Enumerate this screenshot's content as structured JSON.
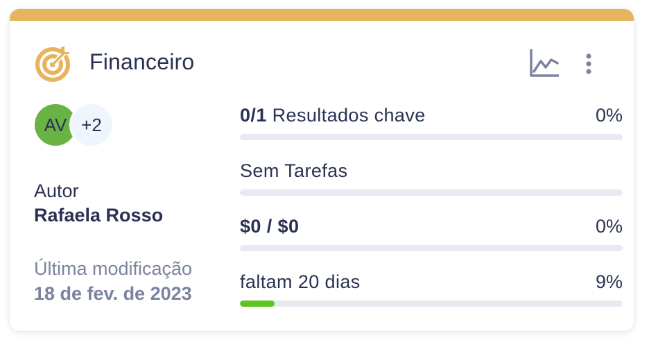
{
  "card": {
    "title": "Financeiro",
    "colors": {
      "accent": "#e7b45e",
      "progress": "#5fc421",
      "avatar": "#69b244"
    },
    "icons": {
      "header": "target-icon",
      "chart": "line-chart-icon",
      "menu": "more-vertical-icon"
    }
  },
  "avatars": {
    "initials": "AV",
    "more": "+2"
  },
  "meta": {
    "author_label": "Autor",
    "author_name": "Rafaela Rosso",
    "modified_label": "Última modificação",
    "modified_date": "18 de fev. de 2023"
  },
  "rows": [
    {
      "bold": "0/1",
      "text": "Resultados chave",
      "percent": "0%",
      "progress": 0
    },
    {
      "bold": "",
      "text": "Sem Tarefas",
      "percent": "",
      "progress": 0
    },
    {
      "bold": "$0 / $0",
      "text": "",
      "percent": "0%",
      "progress": 0
    },
    {
      "bold": "",
      "text": "faltam 20 dias",
      "percent": "9%",
      "progress": 0.09
    }
  ]
}
